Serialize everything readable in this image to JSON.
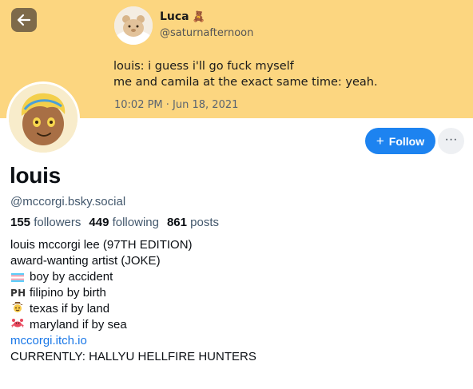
{
  "embedded_post": {
    "author_name": "Luca",
    "author_emoji": "🧸",
    "author_handle": "@saturnafternoon",
    "text_lines": [
      "louis: i guess i'll go fuck myself",
      "me and camila at the exact same time: yeah."
    ],
    "timestamp": "10:02 PM · Jun 18, 2021"
  },
  "header": {
    "back_icon": "arrow-left-icon",
    "follow_label": "Follow",
    "follow_icon": "plus-icon",
    "more_icon": "ellipsis-icon",
    "more_label": "···"
  },
  "profile": {
    "display_name": "louis",
    "handle": "@mccorgi.bsky.social",
    "followers_count": "155",
    "followers_label": "followers",
    "following_count": "449",
    "following_label": "following",
    "posts_count": "861",
    "posts_label": "posts"
  },
  "bio": {
    "line1": "louis mccorgi lee (97TH EDITION)",
    "line2": "award-wanting artist (JOKE)",
    "line3_icon": "transgender-flag-icon",
    "line3": "boy by accident",
    "line4_icon": "ph-flag-icon",
    "line4_icon_text": "PH",
    "line4": "filipino by birth",
    "line5_icon": "cowboy-hat-face-icon",
    "line5": "texas if by land",
    "line6_icon": "crab-icon",
    "line6": "maryland if by sea",
    "link": "mccorgi.itch.io",
    "line8": "CURRENTLY: HALLYU HELLFIRE HUNTERS"
  },
  "colors": {
    "banner": "#fcd680",
    "follow_button": "#1d83f0",
    "link": "#1a78e8",
    "secondary_text": "#42576c"
  }
}
